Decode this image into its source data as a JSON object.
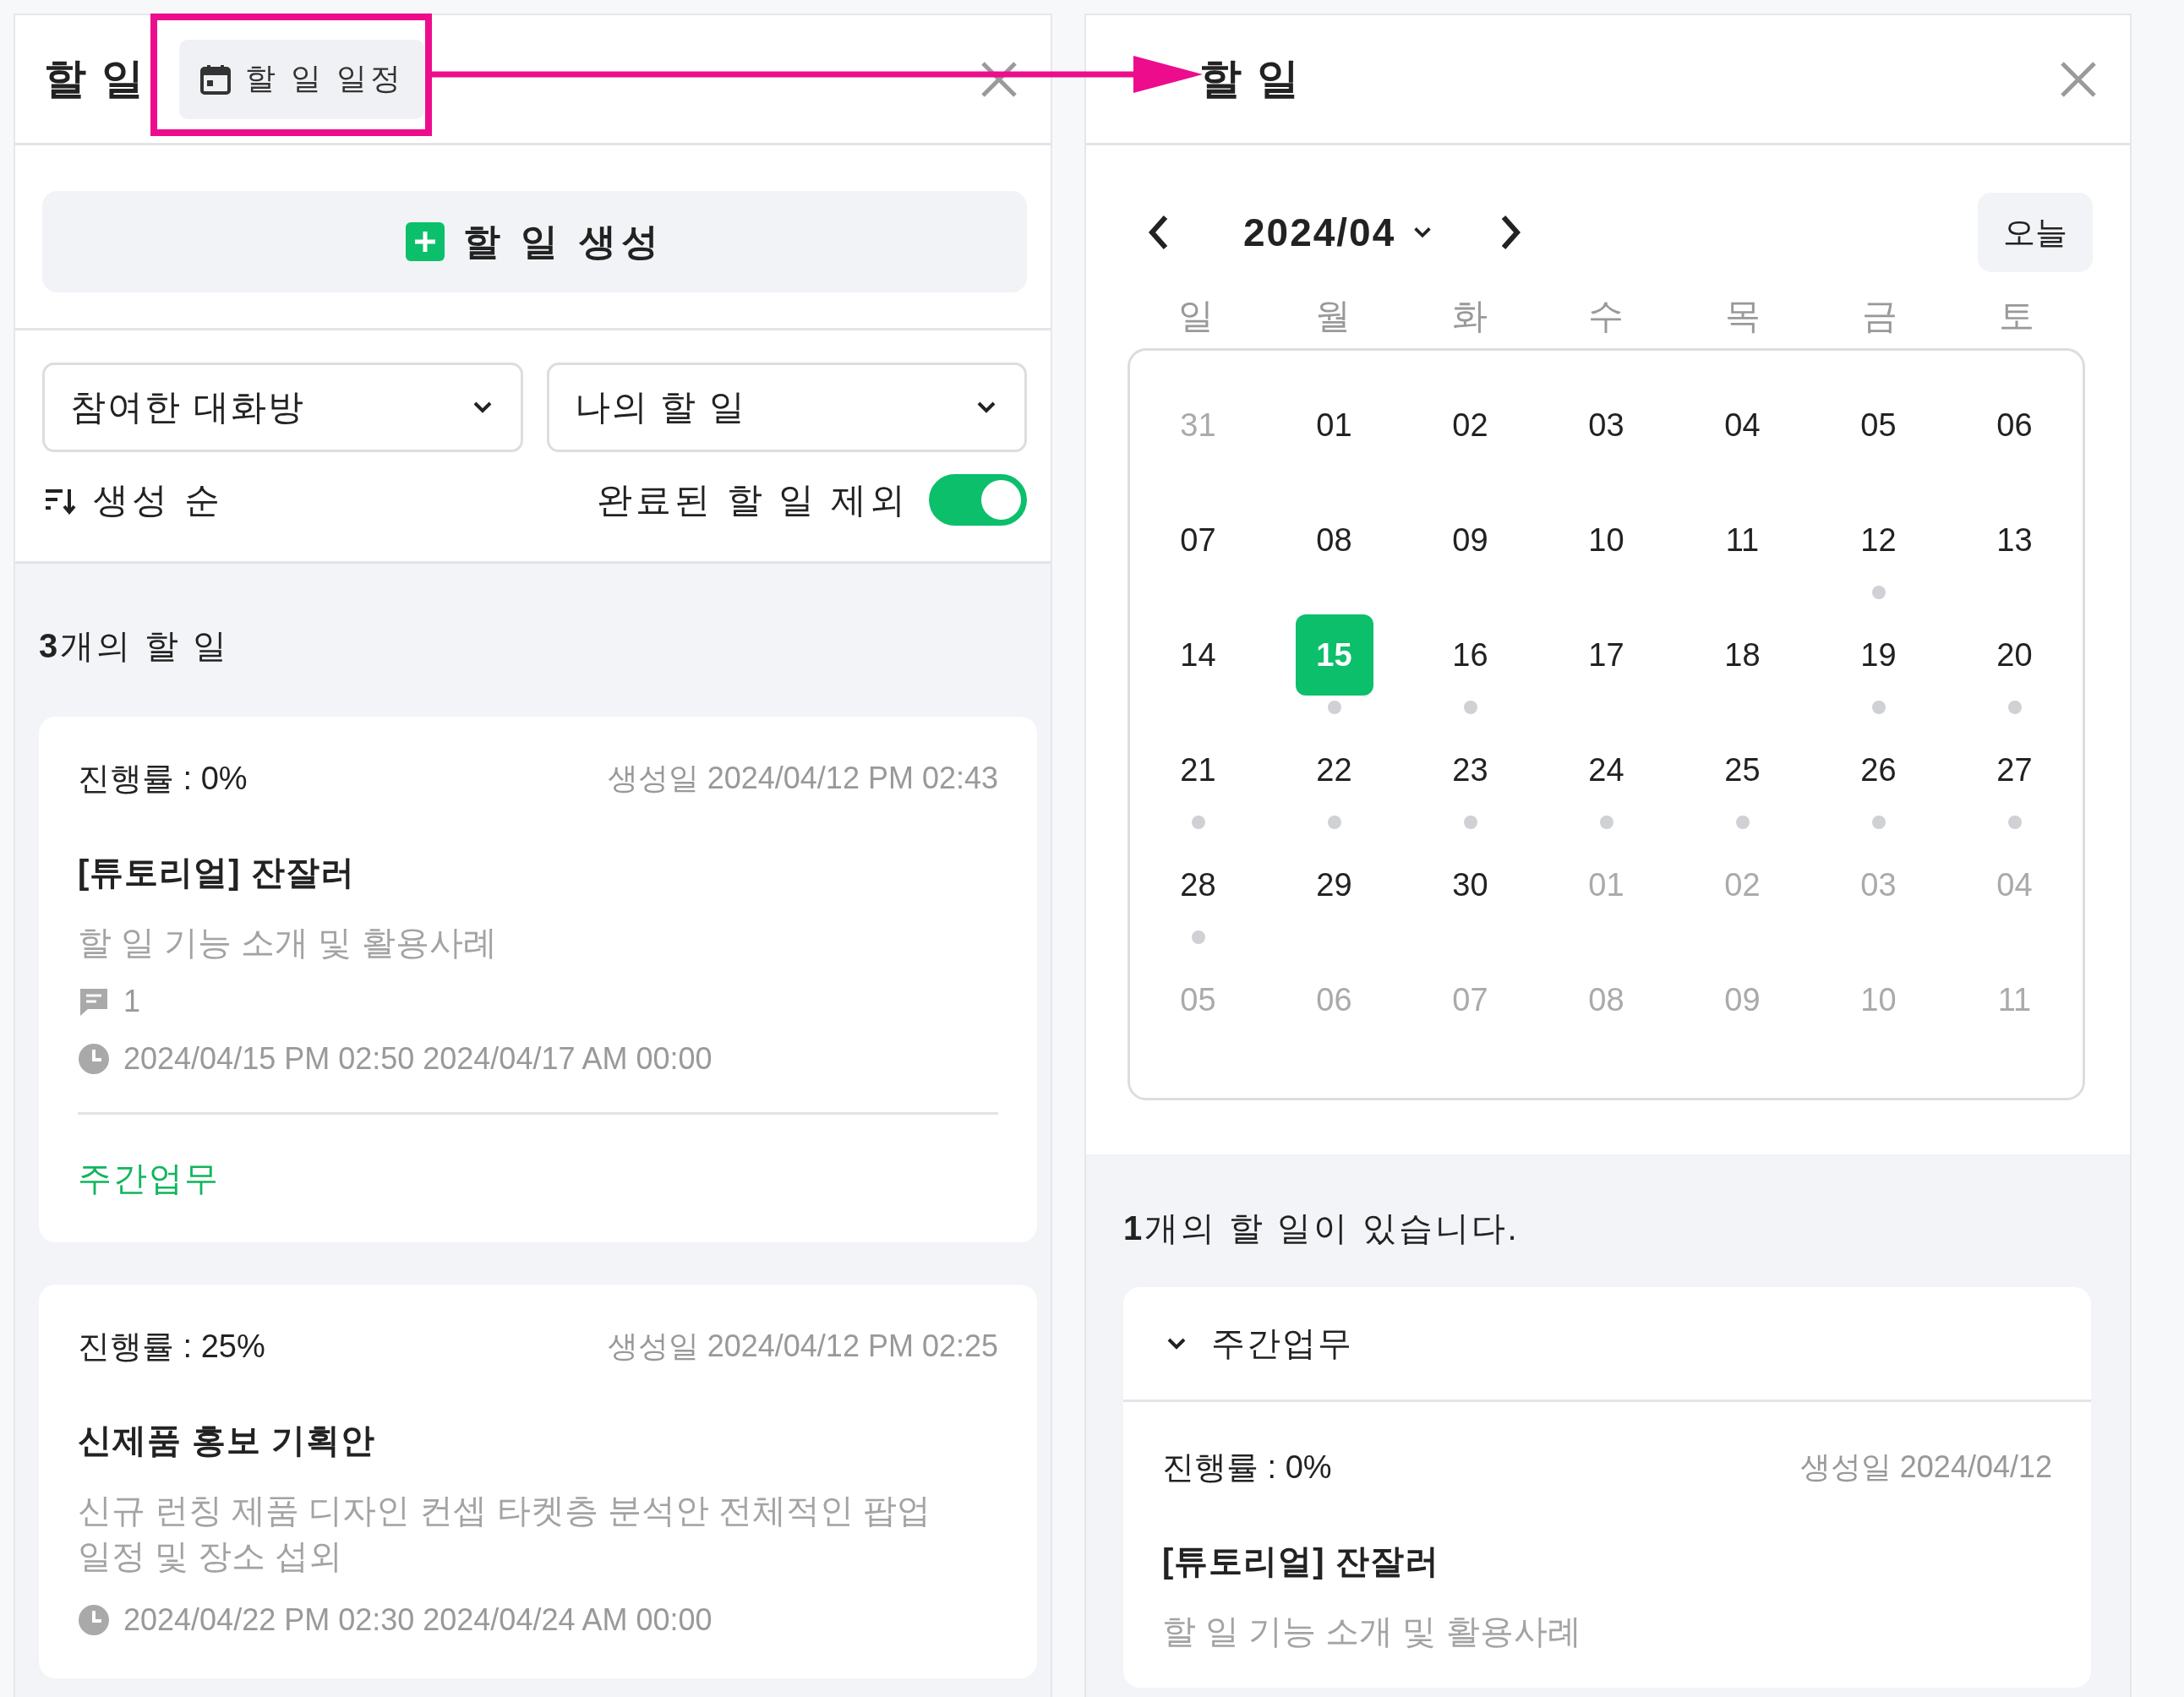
{
  "left_panel": {
    "title": "할 일",
    "schedule_tab": {
      "label": "할 일 일정",
      "highlighted": true
    },
    "create_button": "할 일 생성",
    "filters": [
      {
        "value": "참여한 대화방"
      },
      {
        "value": "나의 할 일"
      }
    ],
    "sort": "생성 순",
    "exclude_completed": {
      "label": "완료된 할 일 제외",
      "on": true
    },
    "count": "**3**개의 할 일",
    "cards": [
      {
        "progress": "진행률 : 0%",
        "created": "생성일 2024/04/12 PM 02:43",
        "title": "[튜토리얼] 잔잘러",
        "description": "할 일 기능 소개 및 활용사례",
        "comments": "1",
        "schedule": "2024/04/15 PM 02:50 2024/04/17 AM 00:00",
        "tag": "주간업무"
      },
      {
        "progress": "진행률 : 25%",
        "created": "생성일 2024/04/12 PM 02:25",
        "title": "신제품 홍보 기획안",
        "description": "신규 런칭 제품 디자인 컨셉 타켓층 분석안 전체적인 팝업 일정 및 장소 섭외",
        "schedule": "2024/04/22 PM 02:30 2024/04/24 AM 00:00"
      }
    ]
  },
  "right_panel": {
    "title": "할 일",
    "month": "2024/04",
    "today_button": "오늘",
    "weekdays": [
      "일",
      "월",
      "화",
      "수",
      "목",
      "금",
      "토"
    ],
    "days": [
      {
        "label": "31",
        "muted": true,
        "selected": false,
        "has_todo": false
      },
      {
        "label": "01",
        "muted": false,
        "selected": false,
        "has_todo": false
      },
      {
        "label": "02",
        "muted": false,
        "selected": false,
        "has_todo": false
      },
      {
        "label": "03",
        "muted": false,
        "selected": false,
        "has_todo": false
      },
      {
        "label": "04",
        "muted": false,
        "selected": false,
        "has_todo": false
      },
      {
        "label": "05",
        "muted": false,
        "selected": false,
        "has_todo": false
      },
      {
        "label": "06",
        "muted": false,
        "selected": false,
        "has_todo": false
      },
      {
        "label": "07",
        "muted": false,
        "selected": false,
        "has_todo": false
      },
      {
        "label": "08",
        "muted": false,
        "selected": false,
        "has_todo": false
      },
      {
        "label": "09",
        "muted": false,
        "selected": false,
        "has_todo": false
      },
      {
        "label": "10",
        "muted": false,
        "selected": false,
        "has_todo": false
      },
      {
        "label": "11",
        "muted": false,
        "selected": false,
        "has_todo": false
      },
      {
        "label": "12",
        "muted": false,
        "selected": false,
        "has_todo": true
      },
      {
        "label": "13",
        "muted": false,
        "selected": false,
        "has_todo": false
      },
      {
        "label": "14",
        "muted": false,
        "selected": false,
        "has_todo": false
      },
      {
        "label": "15",
        "muted": false,
        "selected": true,
        "has_todo": true
      },
      {
        "label": "16",
        "muted": false,
        "selected": false,
        "has_todo": true
      },
      {
        "label": "17",
        "muted": false,
        "selected": false,
        "has_todo": false
      },
      {
        "label": "18",
        "muted": false,
        "selected": false,
        "has_todo": false
      },
      {
        "label": "19",
        "muted": false,
        "selected": false,
        "has_todo": true
      },
      {
        "label": "20",
        "muted": false,
        "selected": false,
        "has_todo": true
      },
      {
        "label": "21",
        "muted": false,
        "selected": false,
        "has_todo": true
      },
      {
        "label": "22",
        "muted": false,
        "selected": false,
        "has_todo": true
      },
      {
        "label": "23",
        "muted": false,
        "selected": false,
        "has_todo": true
      },
      {
        "label": "24",
        "muted": false,
        "selected": false,
        "has_todo": true
      },
      {
        "label": "25",
        "muted": false,
        "selected": false,
        "has_todo": true
      },
      {
        "label": "26",
        "muted": false,
        "selected": false,
        "has_todo": true
      },
      {
        "label": "27",
        "muted": false,
        "selected": false,
        "has_todo": true
      },
      {
        "label": "28",
        "muted": false,
        "selected": false,
        "has_todo": true
      },
      {
        "label": "29",
        "muted": false,
        "selected": false,
        "has_todo": false
      },
      {
        "label": "30",
        "muted": false,
        "selected": false,
        "has_todo": false
      },
      {
        "label": "01",
        "muted": true,
        "selected": false,
        "has_todo": false
      },
      {
        "label": "02",
        "muted": true,
        "selected": false,
        "has_todo": false
      },
      {
        "label": "03",
        "muted": true,
        "selected": false,
        "has_todo": false
      },
      {
        "label": "04",
        "muted": true,
        "selected": false,
        "has_todo": false
      },
      {
        "label": "05",
        "muted": true,
        "selected": false,
        "has_todo": false
      },
      {
        "label": "06",
        "muted": true,
        "selected": false,
        "has_todo": false
      },
      {
        "label": "07",
        "muted": true,
        "selected": false,
        "has_todo": false
      },
      {
        "label": "08",
        "muted": true,
        "selected": false,
        "has_todo": false
      },
      {
        "label": "09",
        "muted": true,
        "selected": false,
        "has_todo": false
      },
      {
        "label": "10",
        "muted": true,
        "selected": false,
        "has_todo": false
      },
      {
        "label": "11",
        "muted": true,
        "selected": false,
        "has_todo": false
      }
    ],
    "summary": "**1**개의 할 일이 있습니다.",
    "group": {
      "label": "주간업무",
      "expanded": true
    },
    "card": {
      "progress": "진행률 : 0%",
      "created": "생성일 2024/04/12",
      "title": "[튜토리얼] 잔잘러",
      "description": "할 일 기능 소개 및 활용사례"
    }
  }
}
